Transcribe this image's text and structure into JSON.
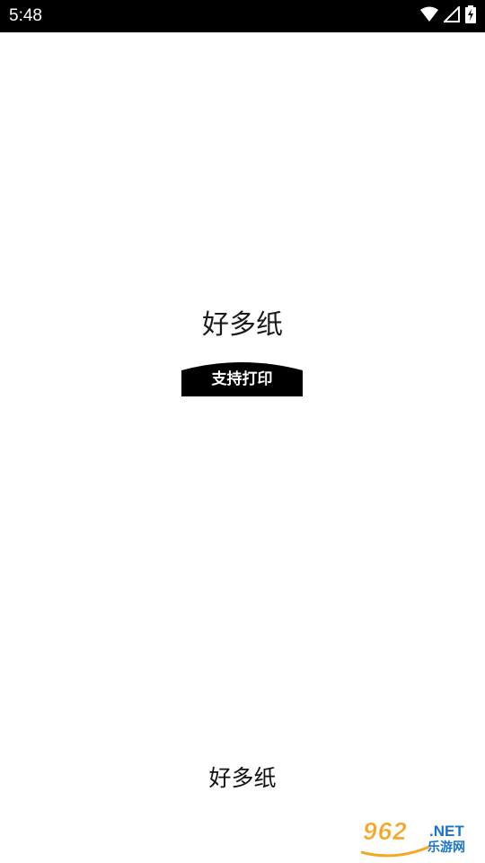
{
  "status_bar": {
    "time": "5:48",
    "icons": [
      "wifi-icon",
      "signal-icon",
      "battery-charging-icon"
    ]
  },
  "splash": {
    "logo_title": "好多纸",
    "logo_badge": "支持打印"
  },
  "footer": {
    "app_name": "好多纸"
  },
  "watermark": {
    "main": "962",
    "suffix": ".NET",
    "sub": "乐游网"
  },
  "colors": {
    "status_bar_bg": "#000000",
    "page_bg": "#ffffff",
    "badge_bg": "#000000",
    "watermark_orange": "#f5a623",
    "watermark_blue": "#1a73c8"
  }
}
